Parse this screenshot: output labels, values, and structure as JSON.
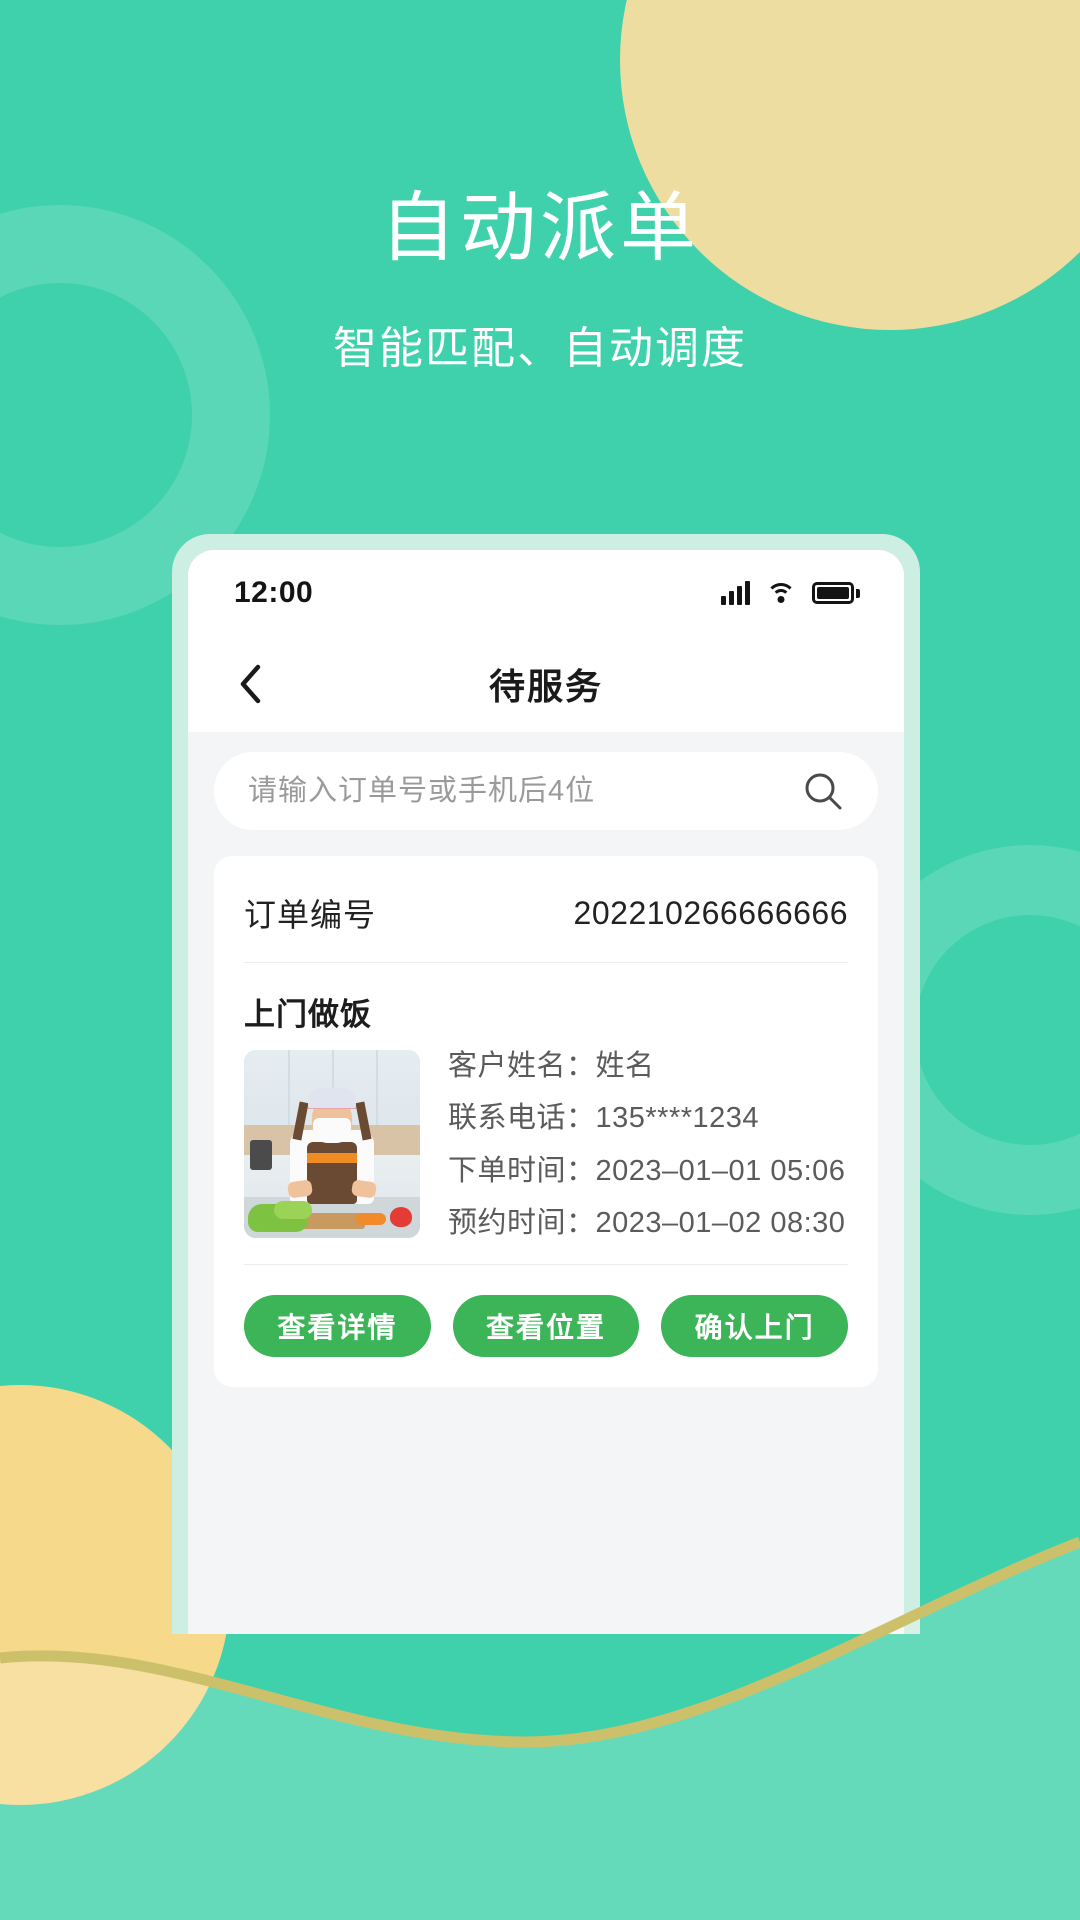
{
  "theme": {
    "background_green": "#3fd1ab",
    "accent_yellow": "#eedda0",
    "button_green": "#3cb458",
    "phone_frame": "#cdeee2",
    "wave_line": "#cdc06a"
  },
  "headline": {
    "title": "自动派单",
    "subtitle": "智能匹配、自动调度"
  },
  "phone": {
    "status_bar": {
      "time": "12:00",
      "icons": [
        "signal-icon",
        "wifi-icon",
        "battery-icon"
      ]
    },
    "nav_bar": {
      "back_icon": "chevron-left-icon",
      "title": "待服务"
    },
    "search": {
      "placeholder": "请输入订单号或手机后4位",
      "value": "",
      "icon": "search-icon"
    },
    "order_card": {
      "order_no_label": "订单编号",
      "order_no_value": "202210266666666",
      "service_title": "上门做饭",
      "thumbnail_alt": "上门做饭服务人员照片",
      "details": [
        {
          "label": "客户姓名：",
          "value": "姓名"
        },
        {
          "label": "联系电话：",
          "value": "135****1234"
        },
        {
          "label": "下单时间：",
          "value": "2023–01–01 05:06"
        },
        {
          "label": "预约时间：",
          "value": "2023–01–02 08:30"
        }
      ],
      "actions": [
        {
          "label": "查看详情",
          "name": "view-details-button"
        },
        {
          "label": "查看位置",
          "name": "view-location-button"
        },
        {
          "label": "确认上门",
          "name": "confirm-visit-button"
        }
      ]
    }
  }
}
